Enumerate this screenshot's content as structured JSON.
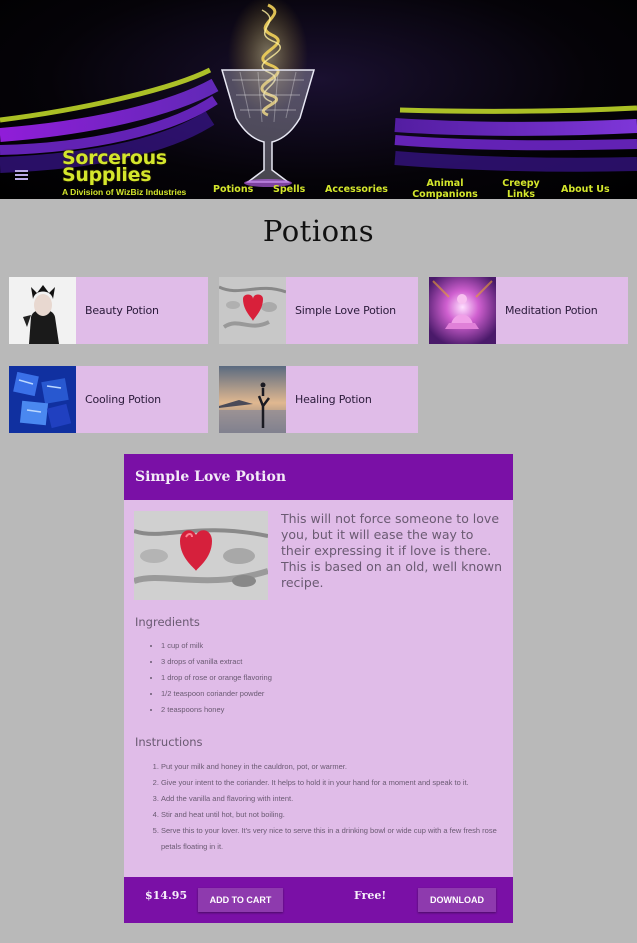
{
  "header": {
    "brand_title": "Sorcerous Supplies",
    "brand_subtitle": "A Division of WizBiz Industries",
    "nav": [
      {
        "label": "Potions"
      },
      {
        "label": "Spells"
      },
      {
        "label": "Accessories"
      },
      {
        "label": "Animal Companions"
      },
      {
        "label": "Creepy Links"
      },
      {
        "label": "About Us"
      }
    ],
    "accent_color": "#d4e62c"
  },
  "page_title": "Potions",
  "products": [
    {
      "label": "Beauty Potion"
    },
    {
      "label": "Simple Love Potion"
    },
    {
      "label": "Meditation Potion"
    },
    {
      "label": "Cooling Potion"
    },
    {
      "label": "Healing Potion"
    }
  ],
  "detail": {
    "title": "Simple Love Potion",
    "description": "This will not force someone to love you, but it will ease the way to their expressing it if love is there. This is based on an old, well known recipe.",
    "ingredients_heading": "Ingredients",
    "ingredients": [
      "1 cup of milk",
      "3 drops of vanilla extract",
      "1 drop of rose or orange flavoring",
      "1/2 teaspoon coriander powder",
      "2 teaspoons honey"
    ],
    "instructions_heading": "Instructions",
    "instructions": [
      "Put your milk and honey in the cauldron, pot, or warmer.",
      "Give your intent to the coriander. It helps to hold it in your hand for a moment and speak to it.",
      "Add the vanilla and flavoring with intent.",
      "Stir and heat until hot, but not boiling.",
      "Serve this to your lover. It's very nice to serve this in a drinking bowl or wide cup with a few fresh rose petals floating in it."
    ],
    "price": "$14.95",
    "add_to_cart_label": "ADD TO CART",
    "free_label": "Free!",
    "download_label": "DOWNLOAD"
  },
  "colors": {
    "panel_header": "#7a10a6",
    "card_bg": "#e0bce8",
    "page_bg": "#b9b9b9"
  }
}
